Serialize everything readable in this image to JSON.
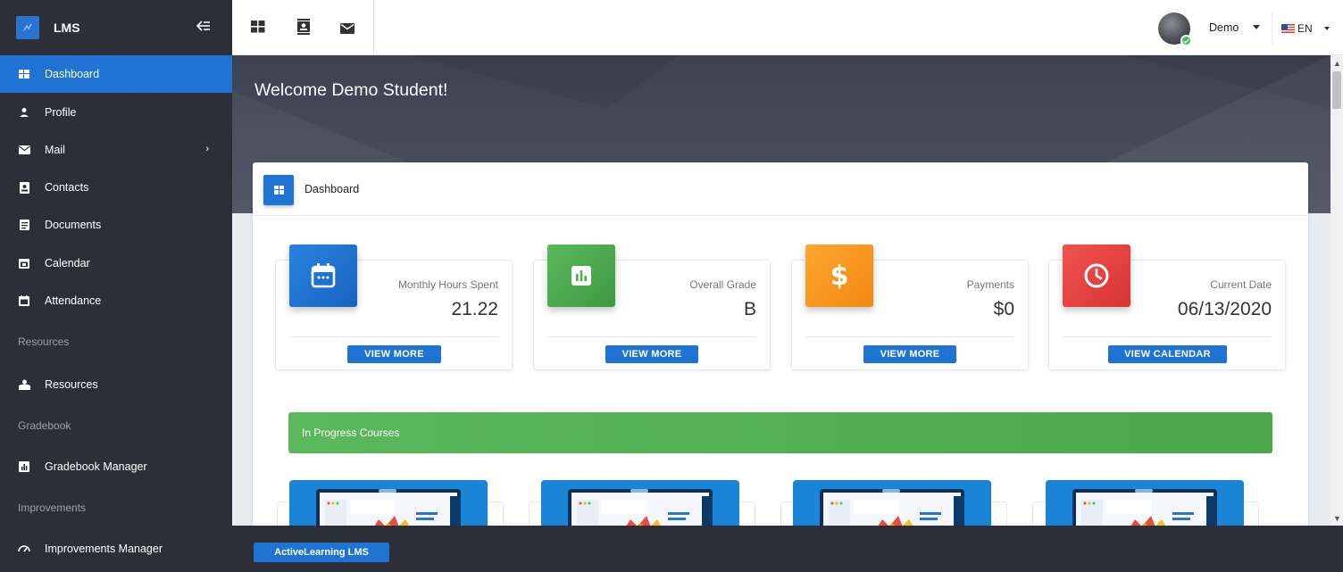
{
  "sidebar": {
    "brand": "LMS",
    "items": [
      {
        "label": "Dashboard",
        "icon": "dashboard-icon"
      },
      {
        "label": "Profile",
        "icon": "user-icon"
      },
      {
        "label": "Mail",
        "icon": "mail-icon",
        "has_children": true
      },
      {
        "label": "Contacts",
        "icon": "contacts-icon"
      },
      {
        "label": "Documents",
        "icon": "documents-icon"
      },
      {
        "label": "Calendar",
        "icon": "calendar-icon"
      },
      {
        "label": "Attendance",
        "icon": "attendance-icon"
      }
    ],
    "sections": [
      {
        "title": "Resources",
        "item": "Resources"
      },
      {
        "title": "Gradebook",
        "item": "Gradebook Manager"
      },
      {
        "title": "Improvements",
        "item": "Improvements Manager"
      }
    ]
  },
  "header": {
    "user_name": "Demo",
    "language": "EN"
  },
  "banner": {
    "welcome": "Welcome Demo Student!"
  },
  "dashboard": {
    "title": "Dashboard",
    "stats": [
      {
        "label": "Monthly Hours Spent",
        "value": "21.22",
        "button": "VIEW MORE",
        "color": "#1f73d3",
        "icon": "calendar-icon"
      },
      {
        "label": "Overall Grade",
        "value": "B",
        "button": "VIEW MORE",
        "color": "#4caf50",
        "icon": "bar-chart-icon"
      },
      {
        "label": "Payments",
        "value": "$0",
        "button": "VIEW MORE",
        "color": "#f7941d",
        "icon": "dollar-icon"
      },
      {
        "label": "Current Date",
        "value": "06/13/2020",
        "button": "VIEW CALENDAR",
        "color": "#e53e3e",
        "icon": "clock-icon"
      }
    ],
    "in_progress_label": "In Progress Courses"
  },
  "footer": {
    "button": "ActiveLearning LMS"
  },
  "colors": {
    "sidebar_bg": "#2b3038",
    "accent": "#1f73d3",
    "banner_bg": "#454a57",
    "success": "#5cb85c"
  }
}
